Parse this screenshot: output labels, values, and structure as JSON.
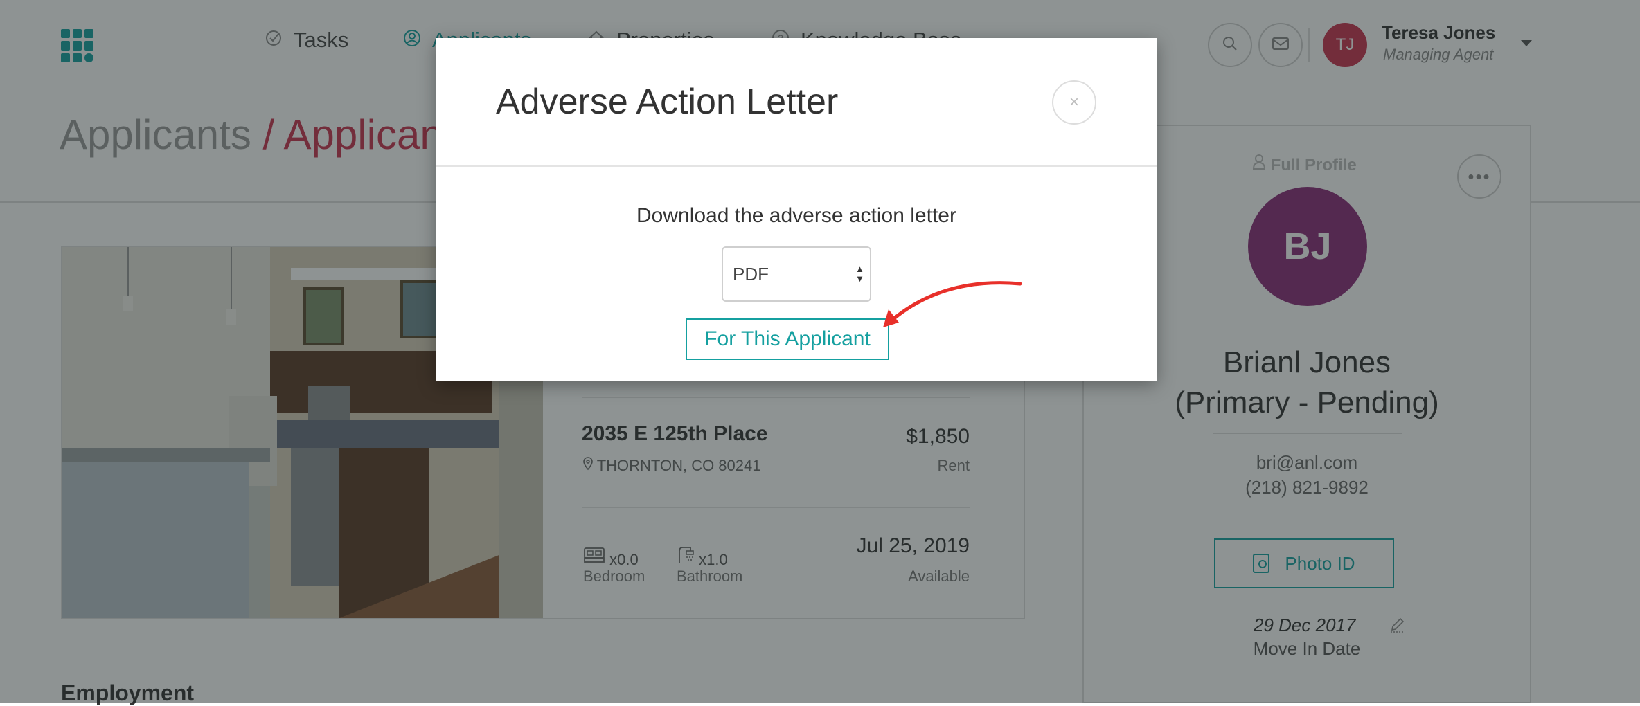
{
  "nav": {
    "items": [
      {
        "label": "Tasks",
        "icon": "check-circle-icon"
      },
      {
        "label": "Applicants",
        "icon": "user-circle-icon"
      },
      {
        "label": "Properties",
        "icon": "home-icon"
      },
      {
        "label": "Knowledge Base",
        "icon": "help-circle-icon"
      }
    ],
    "user": {
      "initials": "TJ",
      "name": "Teresa Jones",
      "role": "Managing Agent"
    }
  },
  "breadcrumb": {
    "parent": "Applicants",
    "separator": " / ",
    "current": "Applicant"
  },
  "property": {
    "name": "2035 E 125th Place",
    "address": "THORNTON, CO 80241",
    "price": "$1,850",
    "price_label": "Rent",
    "bedrooms": "x0.0",
    "bedroom_label": "Bedroom",
    "bathrooms": "x1.0",
    "bathroom_label": "Bathroom",
    "available_date": "Jul 25, 2019",
    "available_label": "Available"
  },
  "section": {
    "employment": "Employment"
  },
  "profile": {
    "full_profile_label": "Full Profile",
    "initials": "BJ",
    "name_line1": "Brianl Jones",
    "name_line2": "(Primary - Pending)",
    "email": "bri@anl.com",
    "phone": "(218) 821-9892",
    "photo_id_label": "Photo ID",
    "move_in_date": "29 Dec 2017",
    "move_in_label": "Move In Date"
  },
  "modal": {
    "title": "Adverse Action Letter",
    "close_symbol": "×",
    "description": "Download the adverse action letter",
    "format_selected": "PDF",
    "button_label": "For This Applicant"
  },
  "colors": {
    "accent": "#15a0a0",
    "brand_red": "#c8334f",
    "avatar_purple": "#8b2a78",
    "annotation_arrow": "#e8302a"
  }
}
